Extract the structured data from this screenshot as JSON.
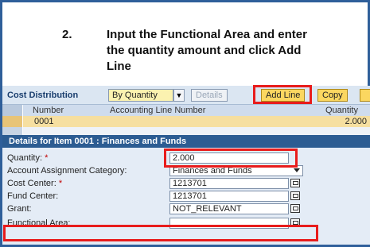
{
  "instruction": {
    "number": "2.",
    "text": "Input the Functional Area and enter the quantity amount and click Add Line"
  },
  "toolbar": {
    "title": "Cost Distribution",
    "distribution_select": "By Quantity",
    "details_label": "Details",
    "add_line_label": "Add Line",
    "copy_label": "Copy"
  },
  "table": {
    "headers": [
      "Number",
      "Accounting Line Number",
      "Quantity"
    ],
    "rows": [
      {
        "number": "0001",
        "quantity": "2.000"
      }
    ]
  },
  "details": {
    "title": "Details for Item 0001 : Finances and Funds",
    "fields": {
      "quantity": {
        "label": "Quantity:",
        "value": "2.000"
      },
      "assignment": {
        "label": "Account Assignment Category:",
        "value": "Finances and Funds"
      },
      "cost_center": {
        "label": "Cost Center:",
        "value": "1213701"
      },
      "fund_center": {
        "label": "Fund Center:",
        "value": "1213701"
      },
      "grant": {
        "label": "Grant:",
        "value": "NOT_RELEVANT"
      },
      "functional_area": {
        "label": "Functional Area:",
        "value": ""
      }
    }
  },
  "colors": {
    "highlight": "#e81c1c",
    "header_blue": "#2c5c92",
    "selected_row": "#f6dfa0"
  }
}
